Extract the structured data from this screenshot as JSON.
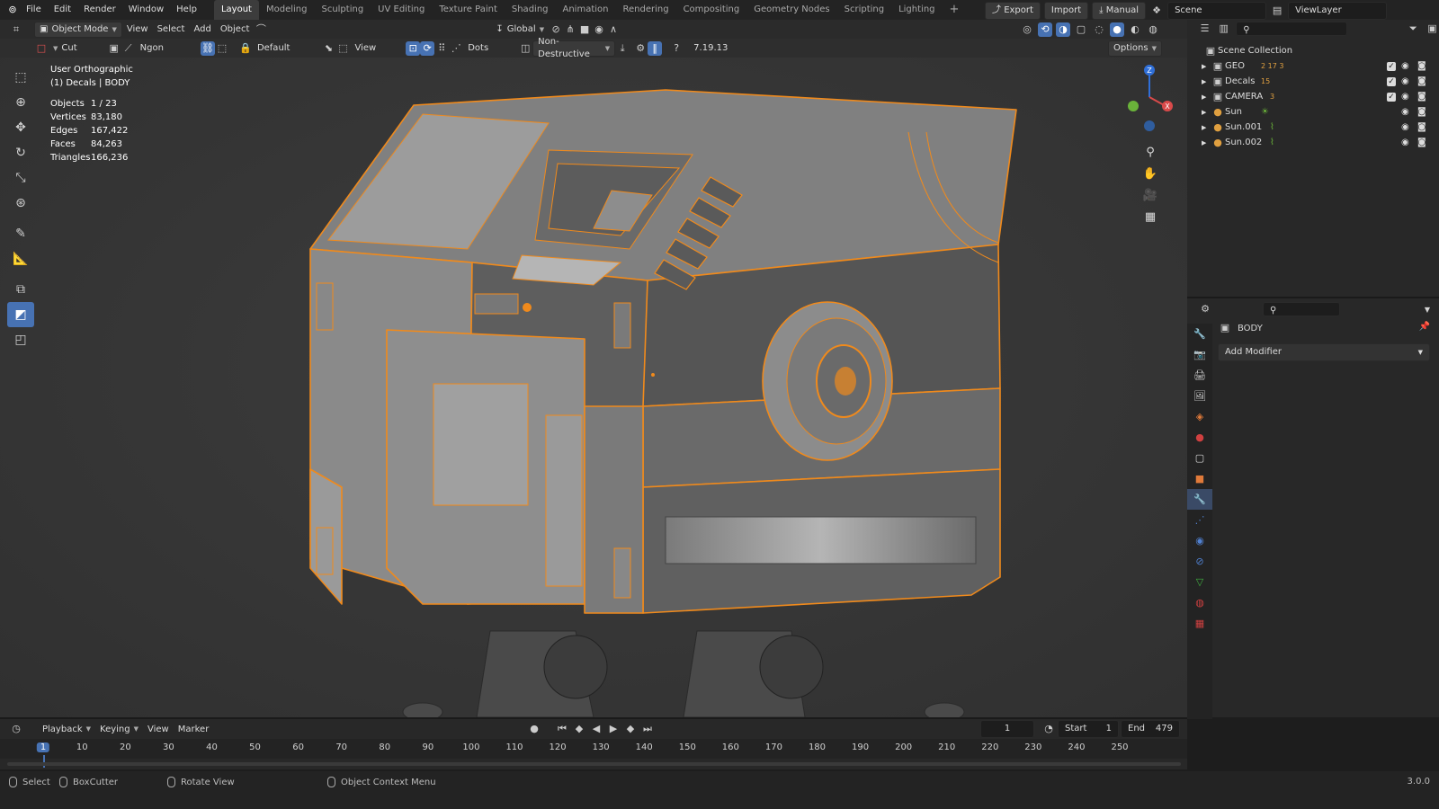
{
  "topbar": {
    "menus": [
      "File",
      "Edit",
      "Render",
      "Window",
      "Help"
    ],
    "workspaces": [
      "Layout",
      "Modeling",
      "Sculpting",
      "UV Editing",
      "Texture Paint",
      "Shading",
      "Animation",
      "Rendering",
      "Compositing",
      "Geometry Nodes",
      "Scripting",
      "Lighting"
    ],
    "export_label": "Export",
    "import_label": "Import",
    "manual_label": "Manual",
    "scene_name": "Scene",
    "view_layer": "ViewLayer"
  },
  "viewport": {
    "mode": "Object Mode",
    "menus": [
      "View",
      "Select",
      "Add",
      "Object"
    ],
    "orientation": "Global",
    "tool_name": "Cut",
    "shape": "Ngon",
    "default_label": "Default",
    "view_label": "View",
    "dots_label": "Dots",
    "mode_label": "Non-Destructive",
    "version_tag": "7.19.13",
    "options_label": "Options",
    "view_name": "User Orthographic",
    "active_info": "(1) Decals | BODY",
    "stats": [
      {
        "label": "Objects",
        "value": "1 / 23"
      },
      {
        "label": "Vertices",
        "value": "83,180"
      },
      {
        "label": "Edges",
        "value": "167,422"
      },
      {
        "label": "Faces",
        "value": "84,263"
      },
      {
        "label": "Triangles",
        "value": "166,236"
      }
    ],
    "gizmo_axes": {
      "z": "Z",
      "y": "Y",
      "x": "X"
    },
    "colors": {
      "bg": "#393939",
      "select_outline": "#f08a1c",
      "model": "#5a5a5a",
      "accent": "#4772b3"
    }
  },
  "outliner": {
    "root": "Scene Collection",
    "items": [
      {
        "name": "GEO",
        "type": "collection",
        "badge": "2 17 3",
        "checked": true
      },
      {
        "name": "Decals",
        "type": "collection",
        "badge": "15",
        "checked": true
      },
      {
        "name": "CAMERA",
        "type": "collection",
        "badge": "3",
        "checked": true
      },
      {
        "name": "Sun",
        "type": "light",
        "checked": false
      },
      {
        "name": "Sun.001",
        "type": "light",
        "checked": false
      },
      {
        "name": "Sun.002",
        "type": "light",
        "checked": false
      }
    ]
  },
  "properties": {
    "object_name": "BODY",
    "add_modifier": "Add Modifier"
  },
  "timeline": {
    "menus": [
      "Playback",
      "Keying",
      "View",
      "Marker"
    ],
    "current_frame": "1",
    "start_label": "Start",
    "start_value": "1",
    "end_label": "End",
    "end_value": "479",
    "ticks": [
      "1",
      "10",
      "20",
      "30",
      "40",
      "50",
      "60",
      "70",
      "80",
      "90",
      "100",
      "110",
      "120",
      "130",
      "140",
      "150",
      "160",
      "170",
      "180",
      "190",
      "200",
      "210",
      "220",
      "230",
      "240",
      "250"
    ]
  },
  "statusbar": {
    "select": "Select",
    "boxcutter": "BoxCutter",
    "rotate": "Rotate View",
    "context": "Object Context Menu",
    "version": "3.0.0"
  }
}
